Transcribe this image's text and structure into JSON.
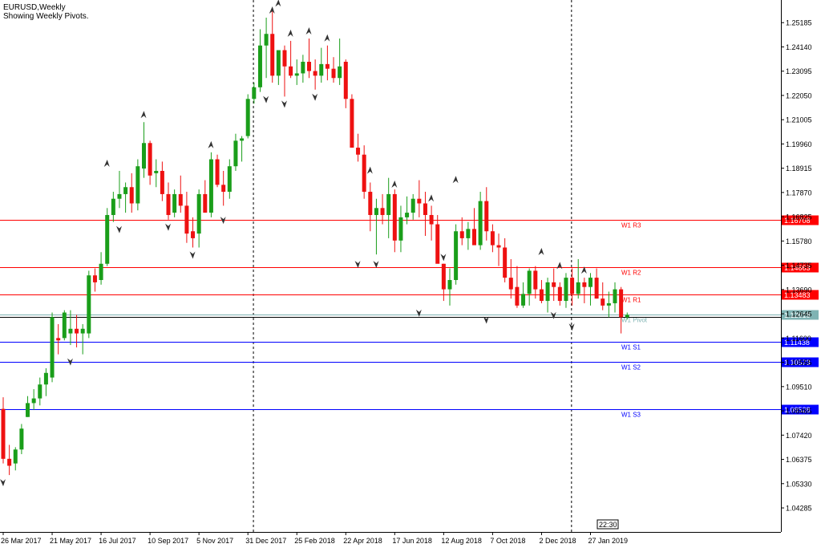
{
  "header": {
    "title": "EURUSD,Weekly",
    "subtitle": "Showing Weekly Pivots."
  },
  "chart_data": {
    "type": "candlestick",
    "title": "EURUSD,Weekly",
    "subtitle": "Showing Weekly Pivots.",
    "ylim": [
      1.0325,
      1.2616
    ],
    "y_ticks": [
      "1.25185",
      "1.24140",
      "1.23095",
      "1.22050",
      "1.21005",
      "1.19960",
      "1.18915",
      "1.17870",
      "1.16825",
      "1.15780",
      "1.14735",
      "1.13690",
      "1.12645",
      "1.11600",
      "1.10555",
      "1.09510",
      "1.08465",
      "1.07420",
      "1.06375",
      "1.05330",
      "1.04285"
    ],
    "x_ticks": [
      {
        "i": 0,
        "label": "26 Mar 2017"
      },
      {
        "i": 8,
        "label": "21 May 2017"
      },
      {
        "i": 16,
        "label": "16 Jul 2017"
      },
      {
        "i": 24,
        "label": "10 Sep 2017"
      },
      {
        "i": 32,
        "label": "5 Nov 2017"
      },
      {
        "i": 40,
        "label": "31 Dec 2017"
      },
      {
        "i": 48,
        "label": "25 Feb 2018"
      },
      {
        "i": 56,
        "label": "22 Apr 2018"
      },
      {
        "i": 64,
        "label": "17 Jun 2018"
      },
      {
        "i": 72,
        "label": "12 Aug 2018"
      },
      {
        "i": 80,
        "label": "7 Oct 2018"
      },
      {
        "i": 88,
        "label": "2 Dec 2018"
      },
      {
        "i": 96,
        "label": "27 Jan 2019"
      }
    ],
    "separators": [
      40.9,
      92.9
    ],
    "candles": [
      [
        1.0855,
        1.0905,
        1.062,
        1.064
      ],
      [
        1.064,
        1.07,
        1.057,
        1.061
      ],
      [
        1.062,
        1.069,
        1.059,
        1.068
      ],
      [
        1.068,
        1.079,
        1.066,
        1.077
      ],
      [
        1.082,
        1.091,
        1.082,
        1.088
      ],
      [
        1.088,
        1.094,
        1.085,
        1.09
      ],
      [
        1.09,
        1.099,
        1.087,
        1.096
      ],
      [
        1.096,
        1.103,
        1.091,
        1.101
      ],
      [
        1.099,
        1.127,
        1.097,
        1.125
      ],
      [
        1.116,
        1.122,
        1.109,
        1.115
      ],
      [
        1.116,
        1.128,
        1.115,
        1.127
      ],
      [
        1.118,
        1.128,
        1.113,
        1.12
      ],
      [
        1.12,
        1.126,
        1.112,
        1.118
      ],
      [
        1.118,
        1.122,
        1.109,
        1.12
      ],
      [
        1.118,
        1.145,
        1.116,
        1.143
      ],
      [
        1.143,
        1.146,
        1.136,
        1.14
      ],
      [
        1.141,
        1.153,
        1.139,
        1.148
      ],
      [
        1.148,
        1.172,
        1.147,
        1.169
      ],
      [
        1.169,
        1.179,
        1.166,
        1.176
      ],
      [
        1.176,
        1.188,
        1.172,
        1.178
      ],
      [
        1.178,
        1.183,
        1.17,
        1.181
      ],
      [
        1.181,
        1.187,
        1.17,
        1.174
      ],
      [
        1.174,
        1.193,
        1.171,
        1.19
      ],
      [
        1.189,
        1.209,
        1.185,
        1.2
      ],
      [
        1.2,
        1.201,
        1.182,
        1.186
      ],
      [
        1.187,
        1.193,
        1.181,
        1.188
      ],
      [
        1.188,
        1.192,
        1.175,
        1.178
      ],
      [
        1.178,
        1.183,
        1.167,
        1.169
      ],
      [
        1.17,
        1.18,
        1.168,
        1.178
      ],
      [
        1.178,
        1.186,
        1.17,
        1.173
      ],
      [
        1.173,
        1.179,
        1.157,
        1.161
      ],
      [
        1.162,
        1.168,
        1.155,
        1.159
      ],
      [
        1.161,
        1.18,
        1.155,
        1.178
      ],
      [
        1.178,
        1.184,
        1.17,
        1.17
      ],
      [
        1.17,
        1.196,
        1.168,
        1.193
      ],
      [
        1.193,
        1.195,
        1.181,
        1.182
      ],
      [
        1.182,
        1.188,
        1.173,
        1.179
      ],
      [
        1.179,
        1.193,
        1.176,
        1.19
      ],
      [
        1.19,
        1.204,
        1.188,
        1.201
      ],
      [
        1.201,
        1.203,
        1.192,
        1.202
      ],
      [
        1.203,
        1.221,
        1.202,
        1.219
      ],
      [
        1.219,
        1.226,
        1.217,
        1.224
      ],
      [
        1.224,
        1.249,
        1.222,
        1.242
      ],
      [
        1.242,
        1.254,
        1.228,
        1.247
      ],
      [
        1.247,
        1.257,
        1.226,
        1.229
      ],
      [
        1.229,
        1.24,
        1.225,
        1.24
      ],
      [
        1.24,
        1.242,
        1.22,
        1.233
      ],
      [
        1.233,
        1.244,
        1.228,
        1.229
      ],
      [
        1.229,
        1.236,
        1.225,
        1.23
      ],
      [
        1.23,
        1.238,
        1.226,
        1.235
      ],
      [
        1.235,
        1.245,
        1.228,
        1.231
      ],
      [
        1.231,
        1.236,
        1.223,
        1.229
      ],
      [
        1.229,
        1.241,
        1.226,
        1.234
      ],
      [
        1.234,
        1.242,
        1.227,
        1.232
      ],
      [
        1.232,
        1.237,
        1.226,
        1.228
      ],
      [
        1.228,
        1.245,
        1.225,
        1.233
      ],
      [
        1.235,
        1.236,
        1.215,
        1.219
      ],
      [
        1.219,
        1.221,
        1.198,
        1.198
      ],
      [
        1.198,
        1.204,
        1.192,
        1.195
      ],
      [
        1.195,
        1.199,
        1.176,
        1.179
      ],
      [
        1.179,
        1.183,
        1.162,
        1.169
      ],
      [
        1.169,
        1.176,
        1.152,
        1.172
      ],
      [
        1.172,
        1.178,
        1.165,
        1.169
      ],
      [
        1.169,
        1.185,
        1.159,
        1.178
      ],
      [
        1.178,
        1.18,
        1.153,
        1.158
      ],
      [
        1.158,
        1.173,
        1.153,
        1.168
      ],
      [
        1.168,
        1.177,
        1.165,
        1.17
      ],
      [
        1.17,
        1.178,
        1.167,
        1.176
      ],
      [
        1.176,
        1.184,
        1.168,
        1.174
      ],
      [
        1.174,
        1.179,
        1.16,
        1.169
      ],
      [
        1.169,
        1.173,
        1.158,
        1.165
      ],
      [
        1.165,
        1.169,
        1.15,
        1.148
      ],
      [
        1.148,
        1.148,
        1.132,
        1.137
      ],
      [
        1.137,
        1.146,
        1.13,
        1.141
      ],
      [
        1.141,
        1.165,
        1.139,
        1.162
      ],
      [
        1.162,
        1.168,
        1.156,
        1.159
      ],
      [
        1.159,
        1.166,
        1.154,
        1.163
      ],
      [
        1.163,
        1.172,
        1.157,
        1.156
      ],
      [
        1.156,
        1.179,
        1.154,
        1.175
      ],
      [
        1.175,
        1.181,
        1.158,
        1.162
      ],
      [
        1.162,
        1.165,
        1.153,
        1.156
      ],
      [
        1.156,
        1.161,
        1.147,
        1.155
      ],
      [
        1.155,
        1.159,
        1.14,
        1.142
      ],
      [
        1.142,
        1.15,
        1.133,
        1.137
      ],
      [
        1.138,
        1.147,
        1.129,
        1.13
      ],
      [
        1.13,
        1.14,
        1.129,
        1.135
      ],
      [
        1.135,
        1.146,
        1.13,
        1.145
      ],
      [
        1.145,
        1.147,
        1.133,
        1.137
      ],
      [
        1.137,
        1.141,
        1.131,
        1.132
      ],
      [
        1.132,
        1.142,
        1.127,
        1.14
      ],
      [
        1.14,
        1.146,
        1.132,
        1.138
      ],
      [
        1.138,
        1.14,
        1.13,
        1.132
      ],
      [
        1.132,
        1.144,
        1.129,
        1.142
      ],
      [
        1.142,
        1.146,
        1.13,
        1.135
      ],
      [
        1.135,
        1.15,
        1.133,
        1.14
      ],
      [
        1.14,
        1.142,
        1.131,
        1.138
      ],
      [
        1.138,
        1.144,
        1.13,
        1.142
      ],
      [
        1.142,
        1.146,
        1.133,
        1.133
      ],
      [
        1.133,
        1.14,
        1.128,
        1.13
      ],
      [
        1.13,
        1.136,
        1.125,
        1.131
      ],
      [
        1.131,
        1.14,
        1.127,
        1.137
      ],
      [
        1.137,
        1.138,
        1.118,
        1.125
      ],
      [
        1.125,
        1.127,
        1.124,
        1.126
      ]
    ],
    "fractals": [
      {
        "i": 0,
        "type": "down",
        "price": 1.057
      },
      {
        "i": 11,
        "type": "down",
        "price": 1.109
      },
      {
        "i": 17,
        "type": "up",
        "price": 1.188
      },
      {
        "i": 19,
        "type": "down",
        "price": 1.166
      },
      {
        "i": 23,
        "type": "up",
        "price": 1.209
      },
      {
        "i": 27,
        "type": "down",
        "price": 1.167
      },
      {
        "i": 31,
        "type": "down",
        "price": 1.155
      },
      {
        "i": 34,
        "type": "up",
        "price": 1.196
      },
      {
        "i": 36,
        "type": "down",
        "price": 1.17
      },
      {
        "i": 43,
        "type": "down",
        "price": 1.222
      },
      {
        "i": 44,
        "type": "up",
        "price": 1.254
      },
      {
        "i": 45,
        "type": "up",
        "price": 1.257
      },
      {
        "i": 46,
        "type": "down",
        "price": 1.22
      },
      {
        "i": 47,
        "type": "up",
        "price": 1.244
      },
      {
        "i": 50,
        "type": "up",
        "price": 1.245
      },
      {
        "i": 51,
        "type": "down",
        "price": 1.223
      },
      {
        "i": 53,
        "type": "up",
        "price": 1.242
      },
      {
        "i": 58,
        "type": "down",
        "price": 1.151
      },
      {
        "i": 60,
        "type": "up",
        "price": 1.185
      },
      {
        "i": 61,
        "type": "down",
        "price": 1.151
      },
      {
        "i": 64,
        "type": "up",
        "price": 1.179
      },
      {
        "i": 68,
        "type": "down",
        "price": 1.13
      },
      {
        "i": 70,
        "type": "up",
        "price": 1.173
      },
      {
        "i": 72,
        "type": "down",
        "price": 1.154
      },
      {
        "i": 74,
        "type": "up",
        "price": 1.181
      },
      {
        "i": 79,
        "type": "down",
        "price": 1.127
      },
      {
        "i": 88,
        "type": "up",
        "price": 1.15
      },
      {
        "i": 90,
        "type": "down",
        "price": 1.129
      },
      {
        "i": 91,
        "type": "up",
        "price": 1.144
      },
      {
        "i": 93,
        "type": "down",
        "price": 1.124
      },
      {
        "i": 95,
        "type": "up",
        "price": 1.142
      }
    ],
    "pivot_lines": [
      {
        "name": "W1 R3",
        "price": 1.16708,
        "label": "1.16708",
        "color": "#ff0000"
      },
      {
        "name": "W1 R2",
        "price": 1.14663,
        "label": "1.14663",
        "color": "#ff0000"
      },
      {
        "name": "W1 R1",
        "price": 1.13483,
        "label": "1.13483",
        "color": "#ff0000"
      },
      {
        "name": "W1 Pivot",
        "price": 1.12618,
        "label": "1.12618",
        "color": "#7fb3b3"
      },
      {
        "name": "W1 S1",
        "price": 1.11438,
        "label": "1.11438",
        "color": "#0000ff"
      },
      {
        "name": "W1 S2",
        "price": 1.10573,
        "label": "1.10573",
        "color": "#0000ff"
      },
      {
        "name": "W1 S3",
        "price": 1.08528,
        "label": "1.08528",
        "color": "#0000ff"
      }
    ],
    "bid_price": 1.125,
    "time_label": "22:30",
    "colors": {
      "bull": "#1a9e1a",
      "bear": "#ee1111",
      "wick_bull": "#1a9e1a",
      "wick_bear": "#ee1111",
      "grid_axis": "#000000",
      "pivot_line": "#7fb3b3",
      "bid_line": "#000000"
    }
  }
}
